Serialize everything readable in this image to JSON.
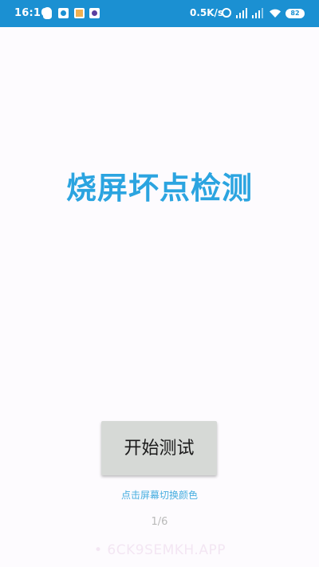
{
  "status_bar": {
    "time": "16:16",
    "net_speed": "0.5K/s",
    "battery": "82",
    "background_color": "#1b90d2",
    "notification_icons": [
      "qq-icon",
      "app-icon",
      "app-icon",
      "app-icon"
    ]
  },
  "main": {
    "title": "烧屏坏点检测",
    "title_color": "#2ba4e0",
    "start_button_label": "开始测试",
    "hint": "点击屏幕切换颜色",
    "page_indicator": "1/6"
  },
  "watermark": {
    "text": "• 6CK9SEMKH.APP"
  }
}
